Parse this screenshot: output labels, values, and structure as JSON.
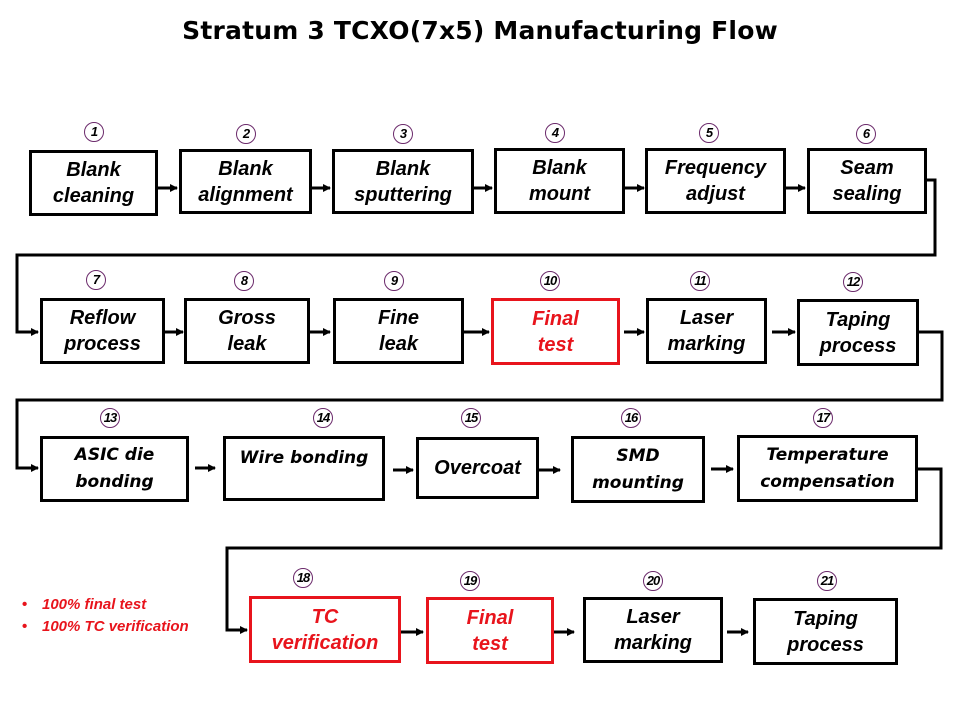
{
  "title": "Stratum 3 TCXO(7x5) Manufacturing Flow",
  "colors": {
    "highlight": "#e8141c",
    "default": "#000000",
    "number_circle": "#6b2a6b"
  },
  "steps": [
    {
      "number": "1",
      "label": "Blank\ncleaning",
      "highlight": false
    },
    {
      "number": "2",
      "label": "Blank\nalignment",
      "highlight": false
    },
    {
      "number": "3",
      "label": "Blank\nsputtering",
      "highlight": false
    },
    {
      "number": "4",
      "label": "Blank\nmount",
      "highlight": false
    },
    {
      "number": "5",
      "label": "Frequency\nadjust",
      "highlight": false
    },
    {
      "number": "6",
      "label": "Seam\nsealing",
      "highlight": false
    },
    {
      "number": "7",
      "label": "Reflow\nprocess",
      "highlight": false
    },
    {
      "number": "8",
      "label": "Gross\nleak",
      "highlight": false
    },
    {
      "number": "9",
      "label": "Fine\nleak",
      "highlight": false
    },
    {
      "number": "10",
      "label": "Final\ntest",
      "highlight": true
    },
    {
      "number": "11",
      "label": "Laser\nmarking",
      "highlight": false
    },
    {
      "number": "12",
      "label": "Taping\nprocess",
      "highlight": false
    },
    {
      "number": "13",
      "label": "ASIC die\nbonding",
      "highlight": false
    },
    {
      "number": "14",
      "label": "Wire bonding",
      "highlight": false
    },
    {
      "number": "15",
      "label": "Overcoat",
      "highlight": false
    },
    {
      "number": "16",
      "label": "SMD\nmounting",
      "highlight": false
    },
    {
      "number": "17",
      "label": "Temperature\ncompensation",
      "highlight": false
    },
    {
      "number": "18",
      "label": "TC\nverification",
      "highlight": true
    },
    {
      "number": "19",
      "label": "Final\ntest",
      "highlight": true
    },
    {
      "number": "20",
      "label": "Laser\nmarking",
      "highlight": false
    },
    {
      "number": "21",
      "label": "Taping\nprocess",
      "highlight": false
    }
  ],
  "notes": [
    "100% final test",
    "100% TC verification"
  ]
}
